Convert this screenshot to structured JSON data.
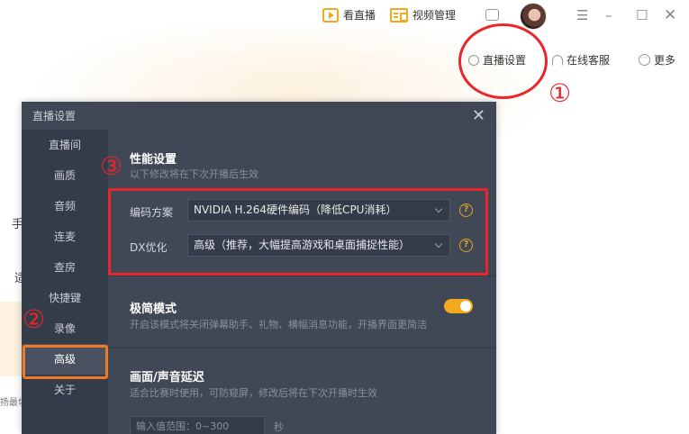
{
  "topbar": {
    "live_label": "看直播",
    "video_label": "视频管理"
  },
  "subbar": {
    "live_settings_label": "直播设置",
    "service_label": "在线客服",
    "more_label": "更多"
  },
  "background_fragments": {
    "frag1": "手",
    "frag2": "适",
    "frag3": "扬最切"
  },
  "annotations": {
    "n1": "①",
    "n2": "②",
    "n3": "③"
  },
  "dialog": {
    "title": "直播设置",
    "sidebar": {
      "items": [
        {
          "label": "直播间"
        },
        {
          "label": "画质"
        },
        {
          "label": "音频"
        },
        {
          "label": "连麦"
        },
        {
          "label": "查房"
        },
        {
          "label": "快捷键"
        },
        {
          "label": "录像"
        },
        {
          "label": "高级"
        },
        {
          "label": "关于"
        }
      ],
      "active_index": 7
    },
    "performance": {
      "title": "性能设置",
      "desc": "以下修改将在下次开播后生效",
      "encode_label": "编码方案",
      "encode_value": "NVIDIA H.264硬件编码（降低CPU消耗）",
      "dx_label": "DX优化",
      "dx_value": "高级（推荐，大幅提高游戏和桌面捕捉性能）"
    },
    "minimal": {
      "title": "极简模式",
      "desc": "开启该模式将关闭弹幕助手、礼物、横幅消息功能，开播界面更简洁",
      "enabled": true
    },
    "delay": {
      "title": "画面/声音延迟",
      "desc": "适合比赛时使用，可防窥屏，修改后将在下次开播时生效",
      "placeholder": "输入值范围：0~300",
      "unit": "秒"
    }
  },
  "colors": {
    "accent": "#f2a91d",
    "annotation_red": "#e8262c",
    "annotation_orange": "#f07a21",
    "dialog_bg": "#404855"
  }
}
